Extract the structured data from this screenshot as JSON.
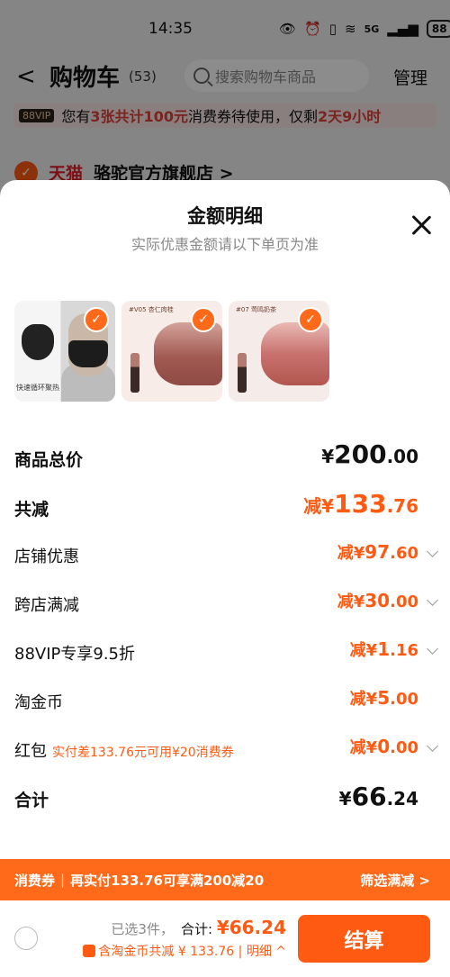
{
  "status_bar": {
    "time": "14:35",
    "network": "5G",
    "battery": "88"
  },
  "header": {
    "back": "<",
    "title": "购物车",
    "count": "(53)",
    "search_placeholder": "搜索购物车商品",
    "manage": "管理"
  },
  "coupon_banner": {
    "vip": "88VIP",
    "pre": "您有",
    "hl1": "3张共计100元",
    "mid": "消费券待使用，仅剩",
    "hl2": "2天9小时"
  },
  "shop": {
    "tmall": "天猫",
    "name": "骆驼官方旗舰店 >"
  },
  "sheet": {
    "title": "金额明细",
    "subtitle": "实际优惠金额请以下单页为准",
    "thumbs": [
      {
        "caption": "快速循环聚热"
      },
      {
        "caption": "#V05 杏仁肉桂"
      },
      {
        "caption": "#07 莺鸣奶茶"
      }
    ],
    "rows": {
      "total_price": {
        "label": "商品总价",
        "cur": "¥",
        "int": "200",
        "dec": ".00"
      },
      "total_reduce": {
        "label": "共减",
        "pre": "减¥",
        "int": "133",
        "dec": ".76"
      },
      "shop_discount": {
        "label": "店铺优惠",
        "pre": "减¥",
        "int": "97",
        "dec": ".60"
      },
      "cross_shop": {
        "label": "跨店满减",
        "pre": "减¥",
        "int": "30",
        "dec": ".00"
      },
      "vip_discount": {
        "label": "88VIP专享9.5折",
        "pre": "减¥",
        "int": "1",
        "dec": ".16"
      },
      "coins": {
        "label": "淘金币",
        "pre": "减¥",
        "int": "5",
        "dec": ".00"
      },
      "red_packet": {
        "label": "红包",
        "note": "实付差133.76元可用¥20消费券",
        "pre": "减¥",
        "int": "0",
        "dec": ".00"
      },
      "sum": {
        "label": "合计",
        "cur": "¥",
        "int": "66",
        "dec": ".24"
      }
    }
  },
  "promo_bar": {
    "tag": "消费券",
    "sep": "|",
    "text": "再实付133.76可享满200减20",
    "filter": "筛选满减 >"
  },
  "checkout": {
    "selected": "已选3件，",
    "total_label": "合计:",
    "total_value": "¥66.24",
    "discount": "含淘金币共减 ¥ 133.76 | 明细 ^",
    "button": "结算"
  },
  "colors": {
    "accent": "#ff5a12",
    "promo": "#ff6a1a"
  }
}
